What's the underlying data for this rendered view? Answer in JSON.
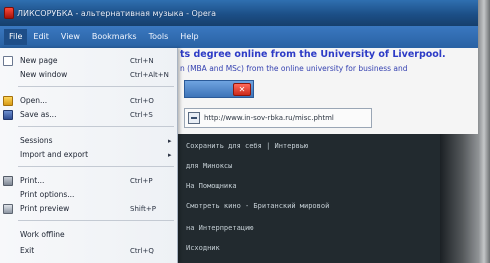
{
  "window": {
    "title": "ЛИКСОРУБКА - альтернативная музыка - Opera"
  },
  "menubar": {
    "items": [
      "File",
      "Edit",
      "View",
      "Bookmarks",
      "Tools",
      "Help"
    ]
  },
  "file_menu": {
    "items": [
      {
        "label": "New page",
        "shortcut": "Ctrl+N",
        "icon": "new-page-icon"
      },
      {
        "label": "New window",
        "shortcut": "Ctrl+Alt+N",
        "icon": ""
      },
      {
        "label": "Open...",
        "shortcut": "Ctrl+O",
        "icon": "folder-icon"
      },
      {
        "label": "Save as...",
        "shortcut": "Ctrl+S",
        "icon": "save-icon"
      },
      {
        "label": "Sessions",
        "shortcut": "",
        "submenu": true,
        "icon": ""
      },
      {
        "label": "Import and export",
        "shortcut": "",
        "submenu": true,
        "icon": ""
      },
      {
        "label": "Print...",
        "shortcut": "Ctrl+P",
        "icon": "print-icon"
      },
      {
        "label": "Print options...",
        "shortcut": "",
        "icon": ""
      },
      {
        "label": "Print preview",
        "shortcut": "Shift+P",
        "icon": "print-preview-icon"
      },
      {
        "label": "Work offline",
        "shortcut": "",
        "icon": ""
      },
      {
        "label": "Exit",
        "shortcut": "Ctrl+Q",
        "icon": ""
      }
    ]
  },
  "page": {
    "headline": "ts degree online from the University of Liverpool.",
    "subline": "n (MBA and MSc) from the online university for business and",
    "close_label": "✕",
    "address": "http://www.in-sov-rbka.ru/misc.phtml"
  },
  "terminal": {
    "lines": [
      "Сохранить для себя | Интервью",
      "для Миноксы",
      "На Помощника",
      "Смотреть кино - Британский мировой",
      "на Интерпретацию",
      "Исходник"
    ]
  }
}
